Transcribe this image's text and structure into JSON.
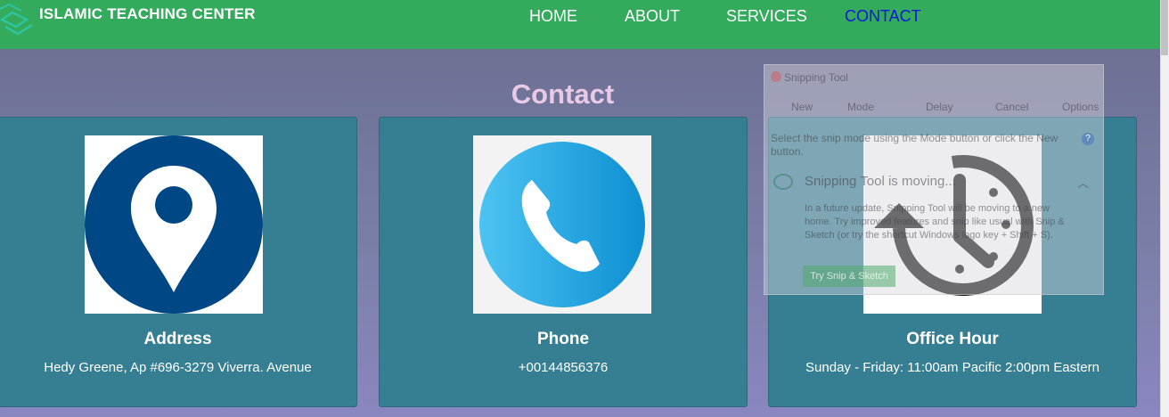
{
  "nav": {
    "brand": "ISLAMIC TEACHING CENTER",
    "links": [
      "HOME",
      "ABOUT",
      "SERVICES",
      "CONTACT"
    ],
    "active": "CONTACT"
  },
  "page": {
    "title": "Contact"
  },
  "cards": [
    {
      "icon": "location-pin-icon",
      "title": "Address",
      "text": "Hedy Greene, Ap #696-3279 Viverra. Avenue"
    },
    {
      "icon": "phone-icon",
      "title": "Phone",
      "text": "+00144856376"
    },
    {
      "icon": "clock-history-icon",
      "title": "Office Hour",
      "text": "Sunday - Friday: 11:00am Pacific 2:00pm Eastern"
    }
  ],
  "snipping_tool": {
    "title": "Snipping Tool",
    "toolbar": [
      "New",
      "Mode",
      "Delay",
      "Cancel",
      "Options"
    ],
    "description": "Select the snip mode using the Mode button or click the New button.",
    "notice_title": "Snipping Tool is moving...",
    "notice_body": "In a future update, Snipping Tool will be moving to a new home. Try improved features and snip like usual with Snip & Sketch (or try the shortcut Windows logo key + Shift + S).",
    "cta": "Try Snip & Sketch"
  },
  "colors": {
    "nav_bg": "#33aa5c",
    "card_bg": "#367f93",
    "title_color": "#e9c9e6",
    "active_link": "#0b18d6",
    "pin_blue": "#004785",
    "phone_blue": "#2aa7e0"
  }
}
